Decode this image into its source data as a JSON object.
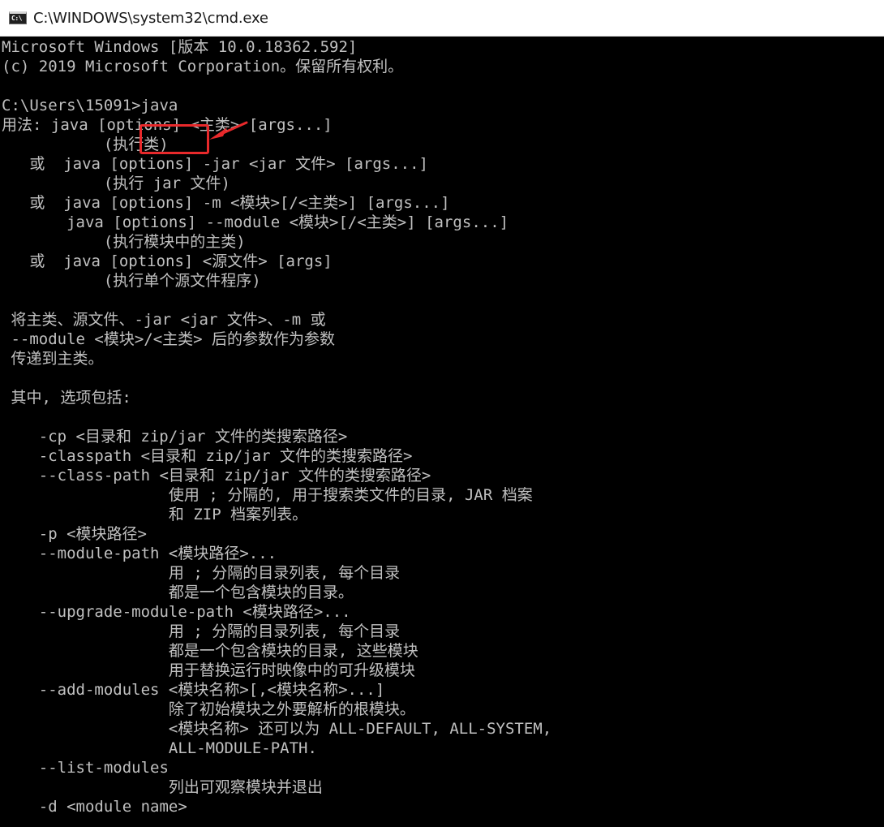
{
  "window": {
    "title": "C:\\WINDOWS\\system32\\cmd.exe",
    "icon": "cmd-console-icon",
    "icon_text": "C:\\"
  },
  "colors": {
    "console_bg": "#000000",
    "console_fg": "#c0c0c0",
    "annotation": "#e8292b"
  },
  "annotation": {
    "icon": "red-arrow-icon"
  },
  "console_lines": [
    "Microsoft Windows [版本 10.0.18362.592]",
    "(c) 2019 Microsoft Corporation。保留所有权利。",
    "",
    "C:\\Users\\15091>java",
    "用法: java [options] <主类> [args...]",
    "           (执行类)",
    "   或  java [options] -jar <jar 文件> [args...]",
    "           (执行 jar 文件)",
    "   或  java [options] -m <模块>[/<主类>] [args...]",
    "       java [options] --module <模块>[/<主类>] [args...]",
    "           (执行模块中的主类)",
    "   或  java [options] <源文件> [args]",
    "           (执行单个源文件程序)",
    "",
    " 将主类、源文件、-jar <jar 文件>、-m 或",
    " --module <模块>/<主类> 后的参数作为参数",
    " 传递到主类。",
    "",
    " 其中, 选项包括:",
    "",
    "    -cp <目录和 zip/jar 文件的类搜索路径>",
    "    -classpath <目录和 zip/jar 文件的类搜索路径>",
    "    --class-path <目录和 zip/jar 文件的类搜索路径>",
    "                  使用 ; 分隔的, 用于搜索类文件的目录, JAR 档案",
    "                  和 ZIP 档案列表。",
    "    -p <模块路径>",
    "    --module-path <模块路径>...",
    "                  用 ; 分隔的目录列表, 每个目录",
    "                  都是一个包含模块的目录。",
    "    --upgrade-module-path <模块路径>...",
    "                  用 ; 分隔的目录列表, 每个目录",
    "                  都是一个包含模块的目录, 这些模块",
    "                  用于替换运行时映像中的可升级模块",
    "    --add-modules <模块名称>[,<模块名称>...]",
    "                  除了初始模块之外要解析的根模块。",
    "                  <模块名称> 还可以为 ALL-DEFAULT, ALL-SYSTEM,",
    "                  ALL-MODULE-PATH.",
    "    --list-modules",
    "                  列出可观察模块并退出",
    "    -d <module name>"
  ]
}
